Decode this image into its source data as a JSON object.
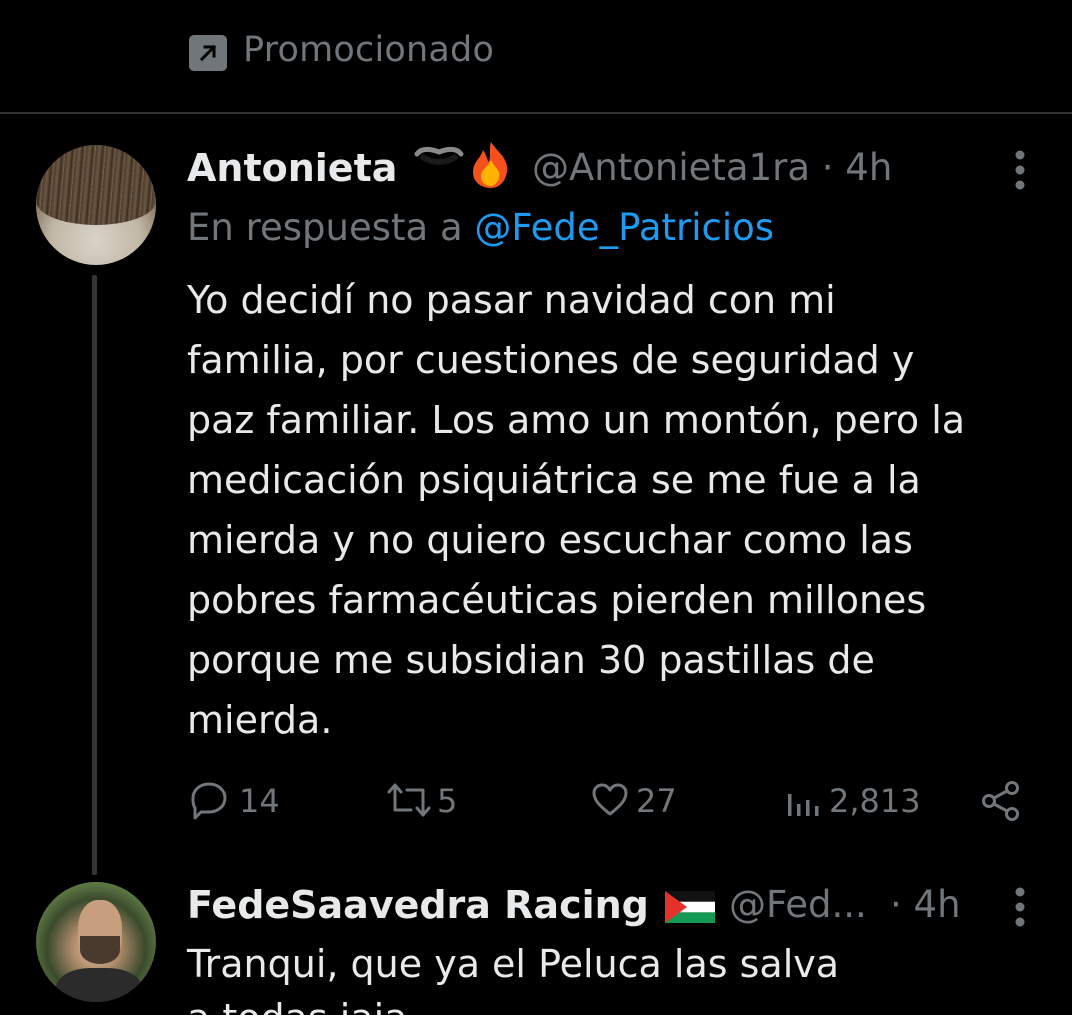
{
  "promoted": {
    "label": "Promocionado",
    "icon": "promoted-arrow-icon"
  },
  "tweet1": {
    "display_name": "Antonieta",
    "emojis": [
      "black-heart-emoji",
      "fire-emoji"
    ],
    "handle": "@Antonieta1ra",
    "time": "· 4h",
    "reply_prefix": "En respuesta a ",
    "reply_mention": "@Fede_Patricios",
    "text_lines": [
      "Yo decidí no pasar navidad con mi",
      "familia, por cuestiones de seguridad y",
      "paz familiar. Los amo un montón, pero la",
      "medicación psiquiátrica se me fue a la",
      "mierda y no quiero escuchar como las",
      "pobres farmacéuticas pierden millones",
      "porque me subsidian 30 pastillas de",
      "mierda."
    ],
    "actions": {
      "replies": "14",
      "retweets": "5",
      "likes": "27",
      "views": "2,813"
    }
  },
  "tweet2": {
    "display_name": "FedeSaavedra Racing",
    "flag": "palestine-flag-emoji",
    "handle": "@Fed...",
    "time": "· 4h",
    "text_line1": "Tranqui, que ya el Peluca las salva",
    "text_line2": "a todas jaja"
  },
  "colors": {
    "background": "#000000",
    "text_primary": "#e7e9ea",
    "text_secondary": "#71767b",
    "link": "#1d9bf0",
    "divider": "#2f3336"
  }
}
